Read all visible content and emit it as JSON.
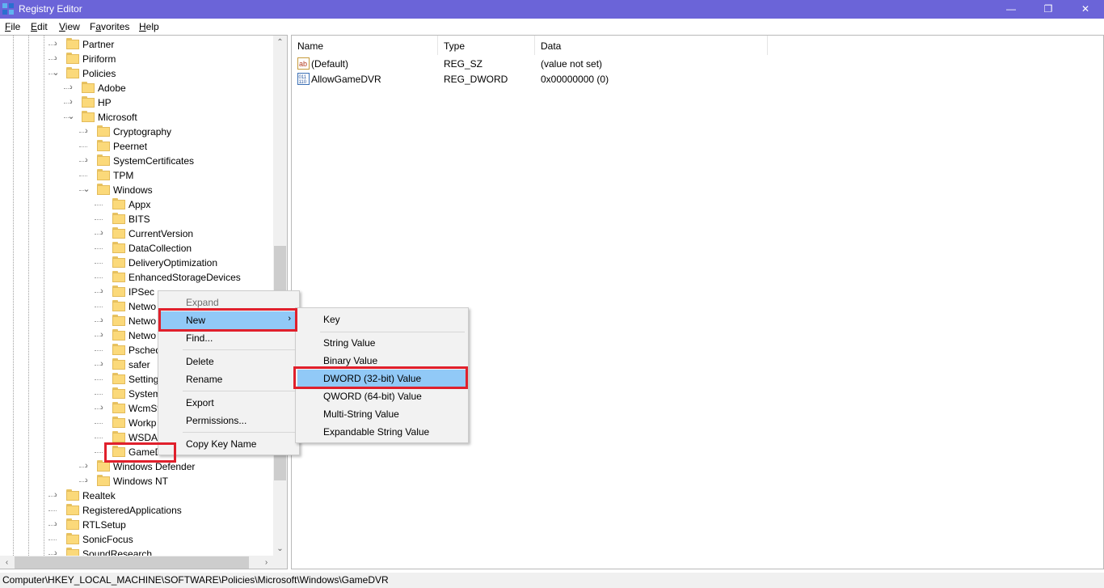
{
  "window": {
    "title": "Registry Editor",
    "minimize_glyph": "—",
    "restore_glyph": "❐",
    "close_glyph": "✕"
  },
  "menu": {
    "items": [
      "File",
      "Edit",
      "View",
      "Favorites",
      "Help"
    ],
    "accel": [
      "F",
      "E",
      "V",
      "a",
      "H"
    ]
  },
  "tree": {
    "nodes": [
      {
        "label": "Partner",
        "expander": "›"
      },
      {
        "label": "Piriform",
        "expander": "›"
      },
      {
        "label": "Policies",
        "expander": "⌄"
      },
      {
        "label": "Adobe",
        "expander": "›"
      },
      {
        "label": "HP",
        "expander": "›"
      },
      {
        "label": "Microsoft",
        "expander": "⌄"
      },
      {
        "label": "Cryptography",
        "expander": "›"
      },
      {
        "label": "Peernet",
        "expander": ""
      },
      {
        "label": "SystemCertificates",
        "expander": "›"
      },
      {
        "label": "TPM",
        "expander": ""
      },
      {
        "label": "Windows",
        "expander": "⌄"
      },
      {
        "label": "Appx",
        "expander": ""
      },
      {
        "label": "BITS",
        "expander": ""
      },
      {
        "label": "CurrentVersion",
        "expander": "›"
      },
      {
        "label": "DataCollection",
        "expander": ""
      },
      {
        "label": "DeliveryOptimization",
        "expander": ""
      },
      {
        "label": "EnhancedStorageDevices",
        "expander": ""
      },
      {
        "label": "IPSec",
        "expander": "›"
      },
      {
        "label": "Netwo",
        "expander": ""
      },
      {
        "label": "Netwo",
        "expander": "›"
      },
      {
        "label": "Netwo",
        "expander": "›"
      },
      {
        "label": "Psched",
        "expander": ""
      },
      {
        "label": "safer",
        "expander": "›"
      },
      {
        "label": "Setting",
        "expander": ""
      },
      {
        "label": "System",
        "expander": ""
      },
      {
        "label": "WcmSv",
        "expander": "›"
      },
      {
        "label": "Workp",
        "expander": ""
      },
      {
        "label": "WSDAP",
        "expander": ""
      },
      {
        "label": "GameD",
        "expander": ""
      },
      {
        "label": "Windows Defender",
        "expander": "›"
      },
      {
        "label": "Windows NT",
        "expander": "›"
      },
      {
        "label": "Realtek",
        "expander": "›"
      },
      {
        "label": "RegisteredApplications",
        "expander": ""
      },
      {
        "label": "RTLSetup",
        "expander": "›"
      },
      {
        "label": "SonicFocus",
        "expander": ""
      },
      {
        "label": "SoundResearch",
        "expander": "›"
      }
    ],
    "scroll_up": "⌃",
    "scroll_down": "⌄",
    "scroll_left": "‹",
    "scroll_right": "›"
  },
  "list": {
    "columns": [
      "Name",
      "Type",
      "Data"
    ],
    "rows": [
      {
        "icon": "string-value-icon",
        "name": "(Default)",
        "type": "REG_SZ",
        "data": "(value not set)"
      },
      {
        "icon": "binary-value-icon",
        "name": "AllowGameDVR",
        "type": "REG_DWORD",
        "data": "0x00000000 (0)"
      }
    ]
  },
  "context_menu": {
    "expand": "Expand",
    "new": "New",
    "new_arrow": "›",
    "find": "Find...",
    "delete": "Delete",
    "rename": "Rename",
    "export": "Export",
    "permissions": "Permissions...",
    "copy_key_name": "Copy Key Name"
  },
  "submenu": {
    "key": "Key",
    "string_value": "String Value",
    "binary_value": "Binary Value",
    "dword_value": "DWORD (32-bit) Value",
    "qword_value": "QWORD (64-bit) Value",
    "multi_string_value": "Multi-String Value",
    "expandable_string_value": "Expandable String Value"
  },
  "status": {
    "path": "Computer\\HKEY_LOCAL_MACHINE\\SOFTWARE\\Policies\\Microsoft\\Windows\\GameDVR"
  },
  "colors": {
    "titlebar": "#6b64d8",
    "highlight": "#91c9f7",
    "annotation_red": "#e0202c"
  }
}
